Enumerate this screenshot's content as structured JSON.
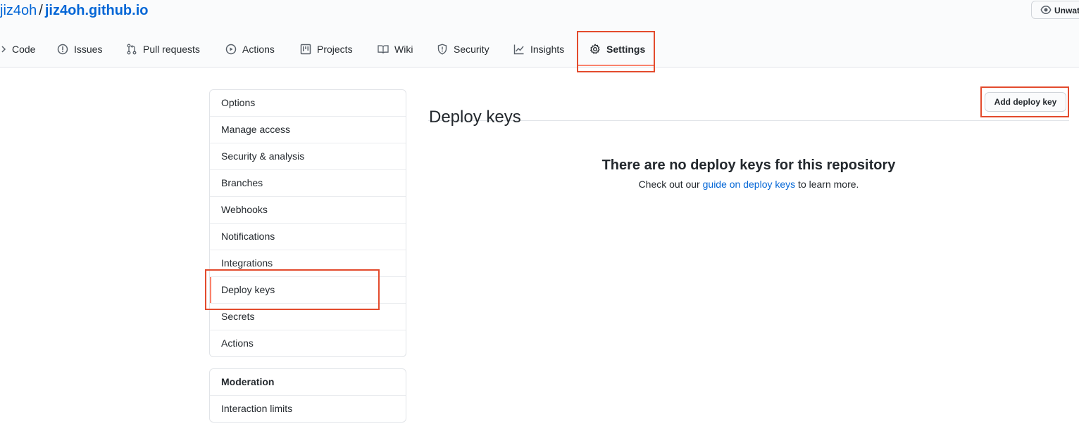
{
  "header": {
    "owner": "jiz4oh",
    "separator": "/",
    "repo": "jiz4oh.github.io",
    "watch_label": "Unwatch"
  },
  "tabs": [
    {
      "label": "Code",
      "icon": "code-icon"
    },
    {
      "label": "Issues",
      "icon": "issue-opened-icon"
    },
    {
      "label": "Pull requests",
      "icon": "git-pull-request-icon"
    },
    {
      "label": "Actions",
      "icon": "play-icon"
    },
    {
      "label": "Projects",
      "icon": "project-icon"
    },
    {
      "label": "Wiki",
      "icon": "book-icon"
    },
    {
      "label": "Security",
      "icon": "shield-icon"
    },
    {
      "label": "Insights",
      "icon": "graph-icon"
    },
    {
      "label": "Settings",
      "icon": "gear-icon",
      "selected": true
    }
  ],
  "sidebar": {
    "items": [
      {
        "label": "Options"
      },
      {
        "label": "Manage access"
      },
      {
        "label": "Security & analysis"
      },
      {
        "label": "Branches"
      },
      {
        "label": "Webhooks"
      },
      {
        "label": "Notifications"
      },
      {
        "label": "Integrations"
      },
      {
        "label": "Deploy keys",
        "selected": true
      },
      {
        "label": "Secrets"
      },
      {
        "label": "Actions"
      }
    ],
    "moderation": {
      "heading": "Moderation",
      "items": [
        {
          "label": "Interaction limits"
        }
      ]
    }
  },
  "main": {
    "title": "Deploy keys",
    "add_button_label": "Add deploy key",
    "blank_title": "There are no deploy keys for this repository",
    "blank_text_before": "Check out our ",
    "blank_link": "guide on deploy keys",
    "blank_text_after": " to learn more."
  },
  "colors": {
    "link": "#0366d6",
    "selected_accent": "#f9826c",
    "annotation_red": "#e34b2d"
  }
}
